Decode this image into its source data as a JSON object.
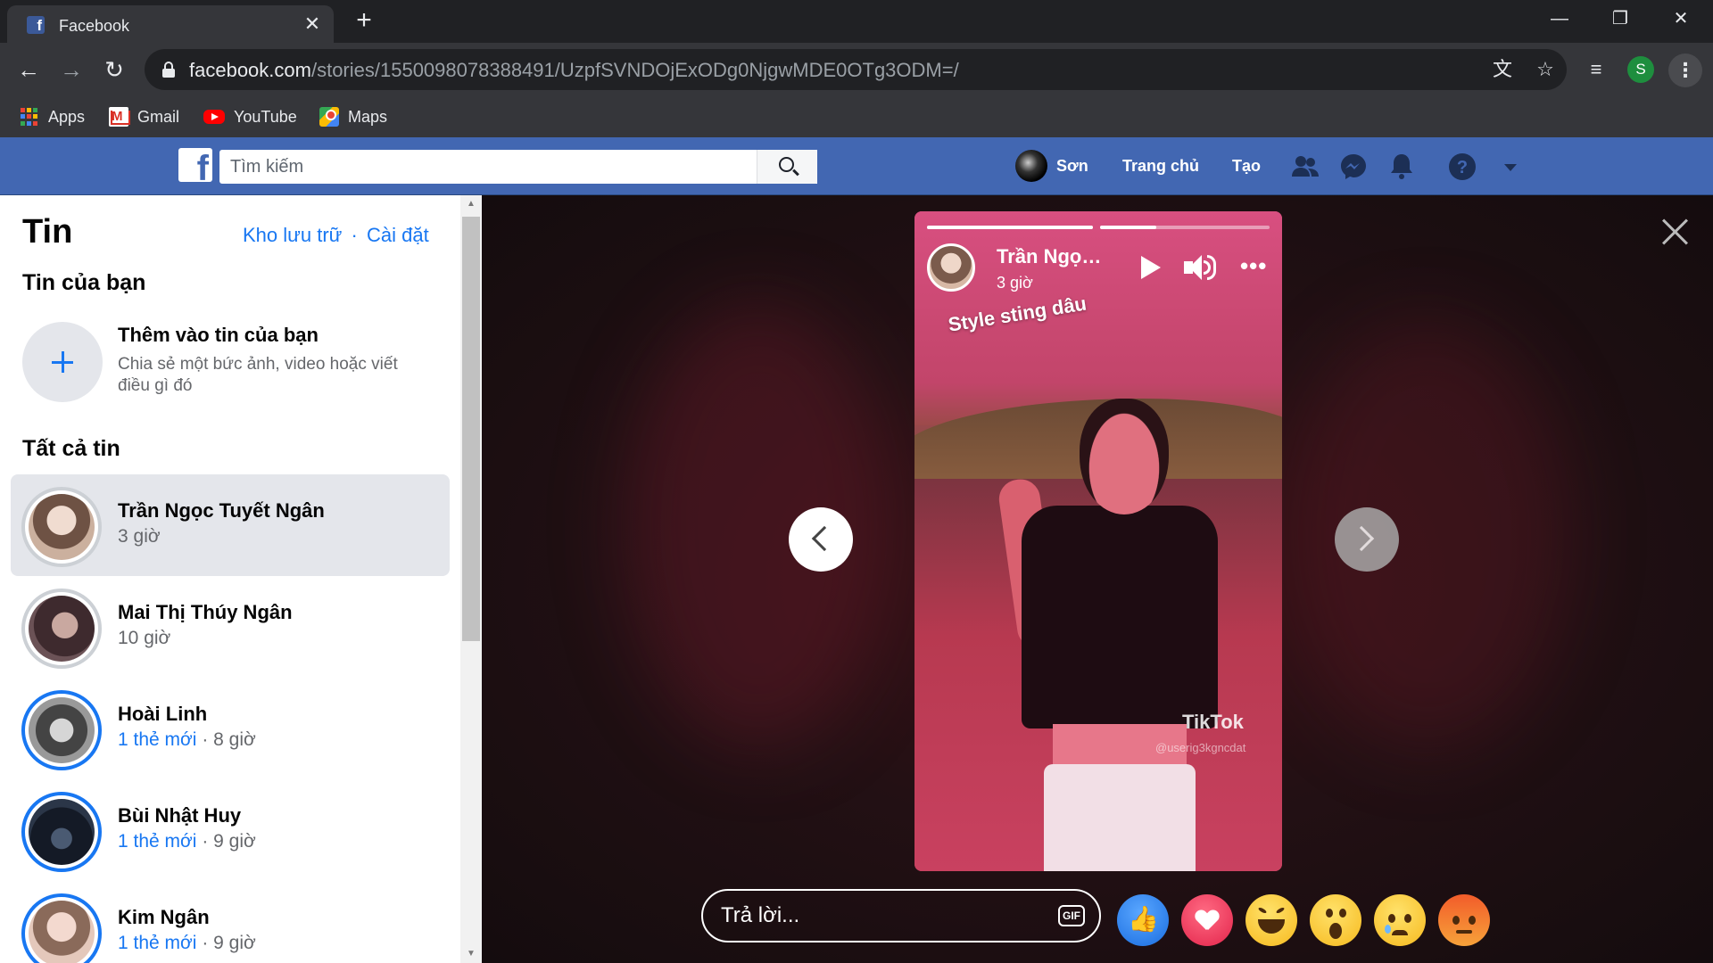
{
  "browser": {
    "tab_title": "Facebook",
    "url_host": "facebook.com",
    "url_path": "/stories/1550098078388491/UzpfSVNDOjExODg0NjgwMDE0OTg3ODM=/",
    "profile_initial": "S",
    "bookmarks": [
      {
        "label": "Apps",
        "icon": "apps-grid-icon"
      },
      {
        "label": "Gmail",
        "icon": "gmail-icon"
      },
      {
        "label": "YouTube",
        "icon": "youtube-icon"
      },
      {
        "label": "Maps",
        "icon": "maps-icon"
      }
    ]
  },
  "fb_header": {
    "search_placeholder": "Tìm kiếm",
    "user_name": "Sơn",
    "home": "Trang chủ",
    "create": "Tạo",
    "icons": [
      "friends-icon",
      "messenger-icon",
      "notifications-icon",
      "help-icon",
      "account-menu-icon"
    ]
  },
  "left_panel": {
    "title": "Tin",
    "archive_link": "Kho lưu trữ",
    "separator": "·",
    "settings_link": "Cài đặt",
    "your_story_heading": "Tin của bạn",
    "add_story_title": "Thêm vào tin của bạn",
    "add_story_desc": "Chia sẻ một bức ảnh, video hoặc viết điều gì đó",
    "all_stories_heading": "Tất cả tin",
    "stories": [
      {
        "name": "Trần Ngọc Tuyết Ngân",
        "new": "",
        "time": "3 giờ",
        "active": true
      },
      {
        "name": "Mai Thị Thúy Ngân",
        "new": "",
        "time": "10 giờ",
        "active": false
      },
      {
        "name": "Hoài Linh",
        "new": "1 thẻ mới",
        "time": " · 8 giờ",
        "active": false
      },
      {
        "name": "Bùi Nhật Huy",
        "new": "1 thẻ mới",
        "time": " · 9 giờ",
        "active": false
      },
      {
        "name": "Kim Ngân",
        "new": "1 thẻ mới",
        "time": " · 9 giờ",
        "active": false
      }
    ]
  },
  "viewer": {
    "author": "Trần Ngọc Tuyết Ngân",
    "time": "3 giờ",
    "caption": "Style sting dâu",
    "watermark": "TikTok",
    "watermark_user": "@userig3kgncdat",
    "progress": [
      1.0,
      0.33
    ],
    "reply_placeholder": "Trả lời...",
    "gif_label": "GIF",
    "reactions": [
      "like-icon",
      "love-icon",
      "haha-icon",
      "wow-icon",
      "sad-icon",
      "angry-icon"
    ]
  }
}
